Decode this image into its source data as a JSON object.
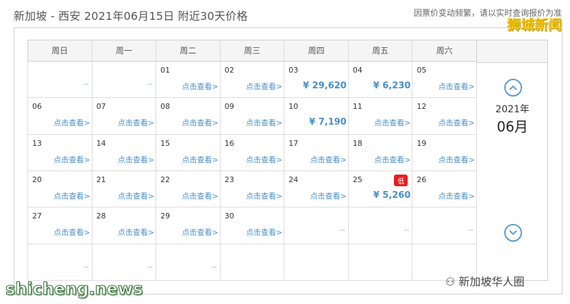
{
  "title": "新加坡 - 西安  2021年06月15日  附近30天价格",
  "notice": "因票价变动频繁，请以实时查询报价为准",
  "watermark_top": "狮城新闻",
  "weekdays": [
    "周日",
    "周一",
    "周二",
    "周三",
    "周四",
    "周五",
    "周六"
  ],
  "link_label": "点击查看>",
  "dash": "--",
  "low_label": "低",
  "cells": [
    {
      "day": "",
      "type": "dash"
    },
    {
      "day": "",
      "type": "dash"
    },
    {
      "day": "01",
      "type": "link"
    },
    {
      "day": "02",
      "type": "link"
    },
    {
      "day": "03",
      "type": "price",
      "price": "¥ 29,620"
    },
    {
      "day": "04",
      "type": "price",
      "price": "¥ 6,230"
    },
    {
      "day": "05",
      "type": "link"
    },
    {
      "day": "06",
      "type": "link"
    },
    {
      "day": "07",
      "type": "link"
    },
    {
      "day": "08",
      "type": "link"
    },
    {
      "day": "09",
      "type": "link"
    },
    {
      "day": "10",
      "type": "price",
      "price": "¥ 7,190"
    },
    {
      "day": "11",
      "type": "link"
    },
    {
      "day": "12",
      "type": "link"
    },
    {
      "day": "13",
      "type": "link"
    },
    {
      "day": "14",
      "type": "link"
    },
    {
      "day": "15",
      "type": "link"
    },
    {
      "day": "16",
      "type": "link"
    },
    {
      "day": "17",
      "type": "link"
    },
    {
      "day": "18",
      "type": "link"
    },
    {
      "day": "19",
      "type": "link"
    },
    {
      "day": "20",
      "type": "link"
    },
    {
      "day": "21",
      "type": "link"
    },
    {
      "day": "22",
      "type": "link"
    },
    {
      "day": "23",
      "type": "link"
    },
    {
      "day": "24",
      "type": "link"
    },
    {
      "day": "25",
      "type": "price",
      "price": "¥ 5,260",
      "low": true
    },
    {
      "day": "26",
      "type": "link"
    },
    {
      "day": "27",
      "type": "link"
    },
    {
      "day": "28",
      "type": "link"
    },
    {
      "day": "29",
      "type": "link"
    },
    {
      "day": "30",
      "type": "link"
    },
    {
      "day": "",
      "type": "dash"
    },
    {
      "day": "",
      "type": "dash"
    },
    {
      "day": "",
      "type": "dash"
    },
    {
      "day": "",
      "type": "dash"
    },
    {
      "day": "",
      "type": "dash"
    },
    {
      "day": "",
      "type": "dash"
    },
    {
      "day": "",
      "type": "empty"
    },
    {
      "day": "",
      "type": "empty"
    },
    {
      "day": "",
      "type": "empty"
    },
    {
      "day": "",
      "type": "empty"
    }
  ],
  "sidebar": {
    "year": "2021年",
    "month": "06月",
    "up_icon": "chevron-up-circle-icon",
    "down_icon": "chevron-down-circle-icon"
  },
  "watermark_bottom_left": "shicheng.news",
  "watermark_bottom_right": "新加坡华人圈",
  "colors": {
    "link": "#4a90c8",
    "low_badge": "#e81e1e",
    "nav": "#5a9bd3",
    "watermark_top": "#f2c200"
  }
}
